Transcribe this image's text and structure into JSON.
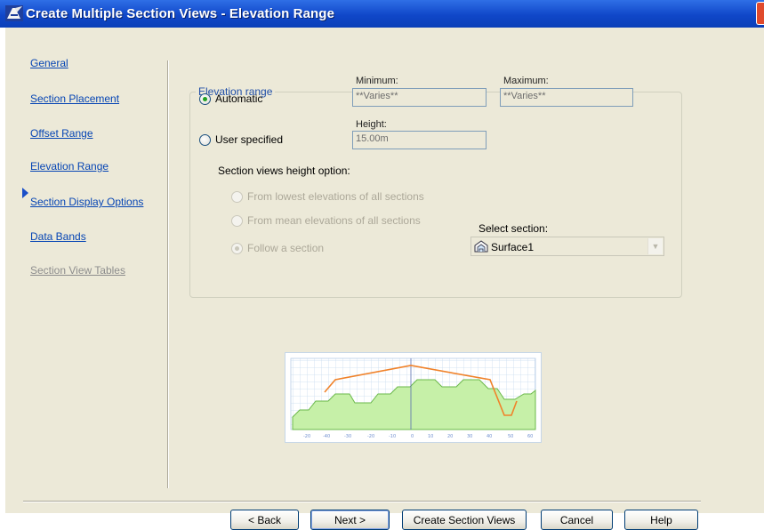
{
  "window": {
    "title": "Create Multiple Section Views - Elevation Range",
    "icon": "autocad-civil-icon",
    "close_icon": "close-icon"
  },
  "nav": {
    "items": [
      {
        "label": "General",
        "state": "link"
      },
      {
        "label": "Section Placement",
        "state": "link"
      },
      {
        "label": "Offset Range",
        "state": "link"
      },
      {
        "label": "Elevation Range",
        "state": "current"
      },
      {
        "label": "Section Display Options",
        "state": "link"
      },
      {
        "label": "Data Bands",
        "state": "link"
      },
      {
        "label": "Section View Tables",
        "state": "disabled"
      }
    ]
  },
  "elevation_range": {
    "group_label": "Elevation range",
    "automatic_label": "Automatic",
    "automatic_checked": true,
    "user_specified_label": "User specified",
    "user_specified_checked": false,
    "minimum_label": "Minimum:",
    "minimum_value": "**Varies**",
    "maximum_label": "Maximum:",
    "maximum_value": "**Varies**",
    "height_label": "Height:",
    "height_value": "15.00m",
    "height_option_label": "Section views height option:",
    "height_options": [
      {
        "label": "From lowest elevations of all sections",
        "checked": false
      },
      {
        "label": "From mean elevations of all sections",
        "checked": false
      },
      {
        "label": "Follow a section",
        "checked": true
      }
    ],
    "select_section_label": "Select section:",
    "select_section_value": "Surface1",
    "select_section_icon": "surface-icon"
  },
  "preview": {
    "ground_color": "#6bb84a",
    "ground_fill": "#c6f0a8",
    "section_line_color": "#f0822a",
    "axis_ticks": [
      "-20",
      "-40",
      "-30",
      "-20",
      "-10",
      "0",
      "10",
      "20",
      "30",
      "40",
      "50",
      "60"
    ]
  },
  "buttons": {
    "back": "< Back",
    "next": "Next >",
    "create": "Create Section Views",
    "cancel": "Cancel",
    "help": "Help"
  }
}
